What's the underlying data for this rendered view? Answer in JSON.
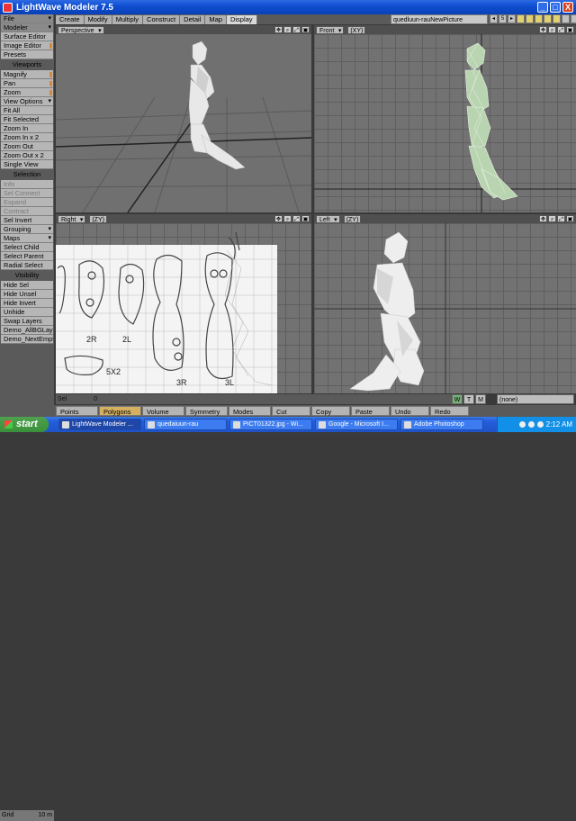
{
  "window": {
    "title": "LightWave Modeler 7.5",
    "min": "_",
    "max": "□",
    "close": "X"
  },
  "tabs": [
    "Create",
    "Modify",
    "Multiply",
    "Construct",
    "Detail",
    "Map",
    "Display"
  ],
  "active_tab": "Display",
  "object_selector": "quedluun-rauNewPicture",
  "layer_label": "5",
  "sidebar": [
    {
      "label": "File",
      "type": "dd dk"
    },
    {
      "label": "Modeler",
      "type": "dd dk"
    },
    {
      "label": "Surface Editor",
      "type": ""
    },
    {
      "label": "Image Editor",
      "type": "or"
    },
    {
      "label": "Presets",
      "type": ""
    },
    {
      "label": "Viewports",
      "type": "hd"
    },
    {
      "label": "Magnify",
      "type": "or"
    },
    {
      "label": "Pan",
      "type": "or"
    },
    {
      "label": "Zoom",
      "type": "or"
    },
    {
      "label": "View Options",
      "type": "dd"
    },
    {
      "label": "Fit All",
      "type": ""
    },
    {
      "label": "Fit Selected",
      "type": ""
    },
    {
      "label": "Zoom In",
      "type": ""
    },
    {
      "label": "Zoom In x 2",
      "type": ""
    },
    {
      "label": "Zoom Out",
      "type": ""
    },
    {
      "label": "Zoom Out x 2",
      "type": ""
    },
    {
      "label": "Single View",
      "type": ""
    },
    {
      "label": "Selection",
      "type": "hd"
    },
    {
      "label": "Info",
      "type": "dis"
    },
    {
      "label": "Sel Connect",
      "type": "dis"
    },
    {
      "label": "Expand",
      "type": "dis"
    },
    {
      "label": "Contract",
      "type": "dis"
    },
    {
      "label": "Sel Invert",
      "type": ""
    },
    {
      "label": "Grouping",
      "type": "dd"
    },
    {
      "label": "Maps",
      "type": "dd"
    },
    {
      "label": "Select Child",
      "type": ""
    },
    {
      "label": "Select Parent",
      "type": ""
    },
    {
      "label": "Radial Select",
      "type": ""
    },
    {
      "label": "Visibility",
      "type": "hd"
    },
    {
      "label": "Hide Sel",
      "type": ""
    },
    {
      "label": "Hide Unsel",
      "type": ""
    },
    {
      "label": "Hide Invert",
      "type": ""
    },
    {
      "label": "Unhide",
      "type": ""
    },
    {
      "label": "Swap Layers",
      "type": ""
    },
    {
      "label": "Demo_AllBGLay",
      "type": ""
    },
    {
      "label": "Demo_NextEmpt",
      "type": ""
    }
  ],
  "viewports": {
    "tl": {
      "mode": "Perspective",
      "axis": ""
    },
    "tr": {
      "mode": "Front",
      "axis": "(XY)"
    },
    "bl": {
      "mode": "Right",
      "axis": "(ZY)"
    },
    "br": {
      "mode": "Left",
      "axis": "(ZY)"
    }
  },
  "vp_icons": [
    "✥",
    "⌕",
    "⤢",
    "▣"
  ],
  "ref_labels": [
    "2R",
    "2L",
    "3R",
    "3L",
    "5X2"
  ],
  "sel_label": "Sel",
  "sel_value": "0",
  "grid_label": "Grid",
  "grid_value": "10 m",
  "wtm": [
    "W",
    "T",
    "M"
  ],
  "none_label": "(none)",
  "bottom_buttons": [
    "Points",
    "Polygons",
    "Volume",
    "Symmetry",
    "Modes",
    "Cut",
    "Copy",
    "Paste",
    "Undo",
    "Redo"
  ],
  "active_bottom": "Polygons",
  "taskbar": {
    "start": "start",
    "items": [
      "LightWave Modeler ...",
      "quedaiuun-rau",
      "PICT01322.jpg - Wi...",
      "Google - Microsoft I...",
      "Adobe Photoshop"
    ],
    "clock": "2:12 AM"
  }
}
